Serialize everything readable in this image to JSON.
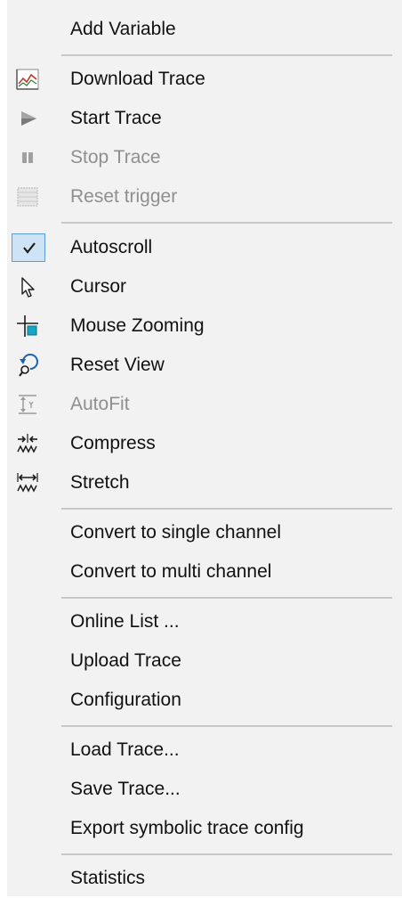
{
  "menu": {
    "items": [
      {
        "label": "Add Variable",
        "icon": null,
        "enabled": true
      },
      {
        "label": "Download Trace",
        "icon": "download-trace-icon",
        "enabled": true
      },
      {
        "label": "Start Trace",
        "icon": "start-trace-icon",
        "enabled": true
      },
      {
        "label": "Stop Trace",
        "icon": "stop-trace-icon",
        "enabled": false
      },
      {
        "label": "Reset trigger",
        "icon": "reset-trigger-icon",
        "enabled": false
      },
      {
        "label": "Autoscroll",
        "icon": "checkmark-icon",
        "enabled": true,
        "checked": true
      },
      {
        "label": "Cursor",
        "icon": "cursor-arrow-icon",
        "enabled": true
      },
      {
        "label": "Mouse Zooming",
        "icon": "mouse-zoom-icon",
        "enabled": true
      },
      {
        "label": "Reset View",
        "icon": "reset-view-icon",
        "enabled": true
      },
      {
        "label": "AutoFit",
        "icon": "autofit-icon",
        "enabled": false
      },
      {
        "label": "Compress",
        "icon": "compress-icon",
        "enabled": true
      },
      {
        "label": "Stretch",
        "icon": "stretch-icon",
        "enabled": true
      },
      {
        "label": "Convert to single channel",
        "icon": null,
        "enabled": true
      },
      {
        "label": "Convert to multi channel",
        "icon": null,
        "enabled": true
      },
      {
        "label": "Online List ...",
        "icon": null,
        "enabled": true
      },
      {
        "label": "Upload Trace",
        "icon": null,
        "enabled": true
      },
      {
        "label": "Configuration",
        "icon": null,
        "enabled": true
      },
      {
        "label": "Load Trace...",
        "icon": null,
        "enabled": true
      },
      {
        "label": "Save Trace...",
        "icon": null,
        "enabled": true
      },
      {
        "label": "Export symbolic trace config",
        "icon": null,
        "enabled": true
      },
      {
        "label": "Statistics",
        "icon": null,
        "enabled": true
      }
    ]
  },
  "colors": {
    "menu_background": "#f2f2f2",
    "text": "#111111",
    "disabled_text": "#8f8f8f",
    "separator": "#c8c8c8",
    "checked_highlight": "#cfe3f7",
    "checked_border": "#5a9bd8",
    "icon_accent": "#1a7fc1"
  }
}
